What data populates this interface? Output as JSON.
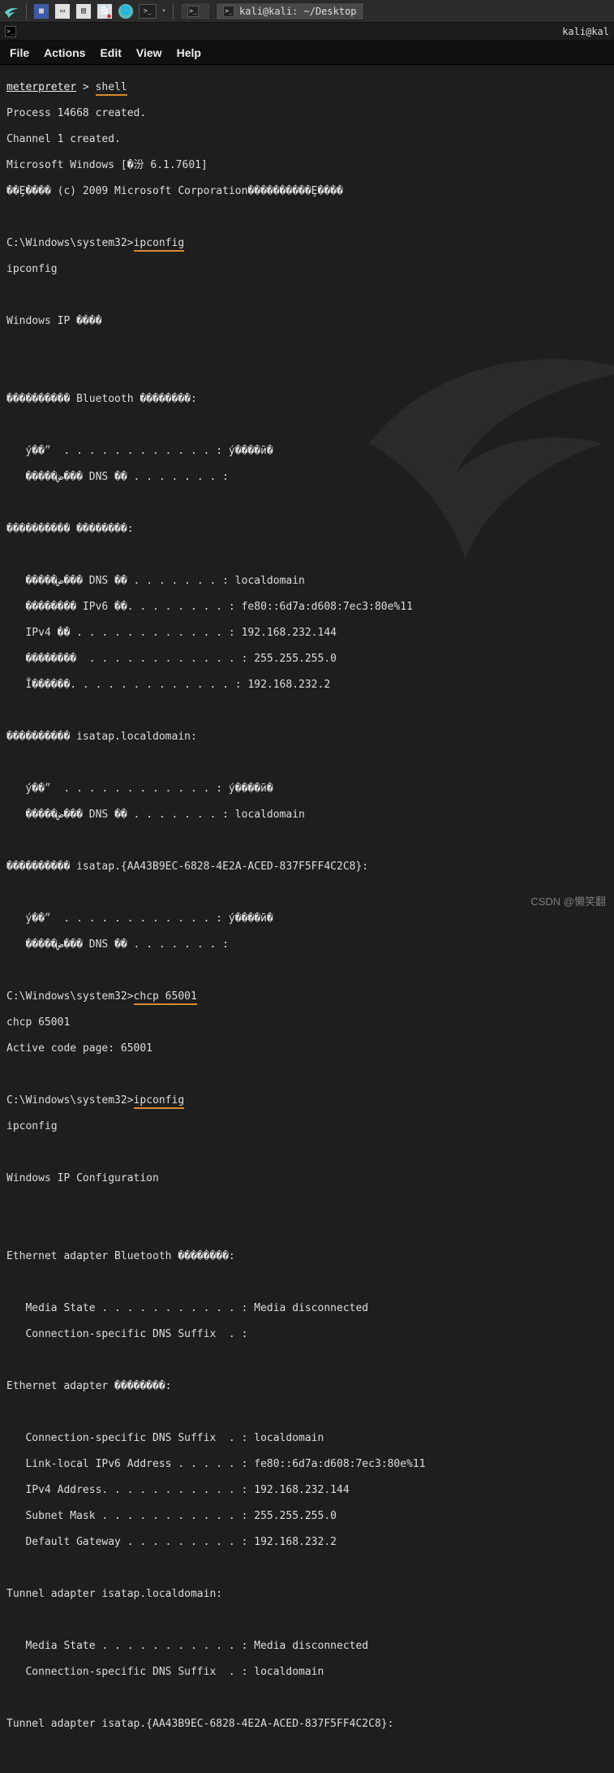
{
  "panel": {
    "task1_label": "",
    "task2_label": "kali@kali: ~/Desktop"
  },
  "win": {
    "title_right": "kali@kal"
  },
  "menu": {
    "file": "File",
    "actions": "Actions",
    "edit": "Edit",
    "view": "View",
    "help": "Help"
  },
  "t": {
    "l1a": "meterpreter",
    "l1b": " > ",
    "l1c": "shell",
    "l2": "Process 14668 created.",
    "l3": "Channel 1 created.",
    "l4": "Microsoft Windows [�汾 6.1.7601]",
    "l5": "��Ȩ���� (c) 2009 Microsoft Corporation����������Ȩ����",
    "l6a": "C:\\Windows\\system32>",
    "l6b": "ipconfig",
    "l7": "ipconfig",
    "l8": "Windows IP ����",
    "l9": "���������� Bluetooth ��������:",
    "l10": "   ý��״  . . . . . . . . . . . . : ý����ӣ�",
    "l11": "   �����ض��� DNS ��׺ . . . . . . . :",
    "l12": "���������� ��������:",
    "l13": "   �����ض��� DNS ��׺ . . . . . . . : localdomain",
    "l14": "   �������� IPv6 ��. . . . . . . . : fe80::6d7a:d608:7ec3:80e%11",
    "l15": "   IPv4 �� . . . . . . . . . . . . : 192.168.232.144",
    "l16": "   ��������  . . . . . . . . . . . . : 255.255.255.0",
    "l17": "   Ĭ������. . . . . . . . . . . . . : 192.168.232.2",
    "l18": "���������� isatap.localdomain:",
    "l19": "   ý��״  . . . . . . . . . . . . : ý����ӣ�",
    "l20": "   �����ض��� DNS ��׺ . . . . . . . : localdomain",
    "l21": "���������� isatap.{AA43B9EC-6828-4E2A-ACED-837F5FF4C2C8}:",
    "l22": "   ý��״  . . . . . . . . . . . . : ý����ӣ�",
    "l23": "   �����ض��� DNS ��׺ . . . . . . . :",
    "l24a": "C:\\Windows\\system32>",
    "l24b": "chcp 65001",
    "l25": "chcp 65001",
    "l26": "Active code page: 65001",
    "l27a": "C:\\Windows\\system32>",
    "l27b": "ipconfig",
    "l28": "ipconfig",
    "l29": "Windows IP Configuration",
    "l30": "Ethernet adapter Bluetooth ��������:",
    "l31": "   Media State . . . . . . . . . . . : Media disconnected",
    "l32": "   Connection-specific DNS Suffix  . :",
    "l33": "Ethernet adapter ��������:",
    "l34": "   Connection-specific DNS Suffix  . : localdomain",
    "l35": "   Link-local IPv6 Address . . . . . : fe80::6d7a:d608:7ec3:80e%11",
    "l36": "   IPv4 Address. . . . . . . . . . . : 192.168.232.144",
    "l37": "   Subnet Mask . . . . . . . . . . . : 255.255.255.0",
    "l38": "   Default Gateway . . . . . . . . . : 192.168.232.2",
    "l39": "Tunnel adapter isatap.localdomain:",
    "l40": "   Media State . . . . . . . . . . . : Media disconnected",
    "l41": "   Connection-specific DNS Suffix  . : localdomain",
    "l42": "Tunnel adapter isatap.{AA43B9EC-6828-4E2A-ACED-837F5FF4C2C8}:"
  },
  "watermark": "CSDN @懒笑翻"
}
